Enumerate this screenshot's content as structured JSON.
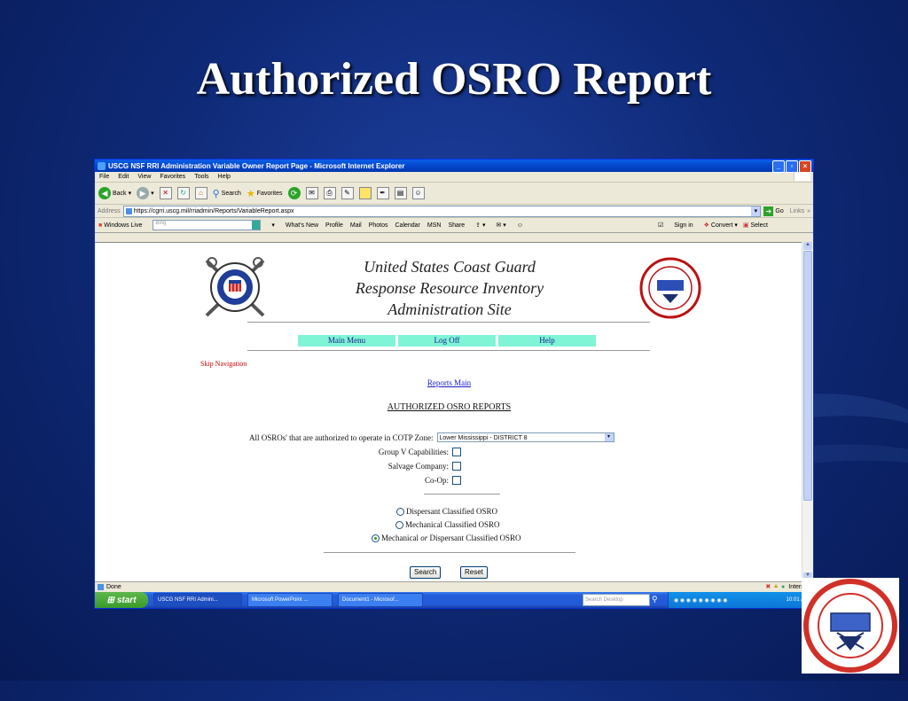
{
  "slide": {
    "title": "Authorized OSRO Report"
  },
  "browser": {
    "window_title": "USCG NSF RRI Administration Variable Owner Report Page - Microsoft Internet Explorer",
    "menu": [
      "File",
      "Edit",
      "View",
      "Favorites",
      "Tools",
      "Help"
    ],
    "toolbar": {
      "back": "Back",
      "search": "Search",
      "favorites": "Favorites"
    },
    "address_label": "Address",
    "address_url": "https://cgrri.uscg.mil/rriadmin/Reports/VariableReport.aspx",
    "go": "Go",
    "links": "Links",
    "links_bar": {
      "windows_live": "Windows Live",
      "bing_placeholder": "Bing",
      "items": [
        "What's New",
        "Profile",
        "Mail",
        "Photos",
        "Calendar",
        "MSN",
        "Share"
      ],
      "sign_in": "Sign in",
      "convert": "Convert",
      "select": "Select"
    },
    "status": "Done",
    "zone": "Internet"
  },
  "page": {
    "site_title": [
      "United States Coast Guard",
      "Response Resource Inventory",
      "Administration Site"
    ],
    "seal_text": "UNITED STATES COAST GUARD",
    "seal_year": "1790",
    "nsf_text": [
      "NATIONAL STRIKE FORCE",
      "NSF",
      "U.S. COAST GUARD"
    ],
    "nav": [
      "Main Menu",
      "Log Off",
      "Help"
    ],
    "skip_navigation": "Skip Navigation",
    "reports_main": "Reports Main",
    "heading": "AUTHORIZED OSRO REPORTS",
    "zone_label": "All OSROs' that are authorized to operate in COTP Zone:",
    "zone_value": "Lower Mississippi - DISTRICT 8",
    "checkboxes": [
      "Group V Capabilities:",
      "Salvage Company:",
      "Co-Op:"
    ],
    "radios": [
      {
        "label": "Dispersant Classified OSRO",
        "selected": false
      },
      {
        "label": "Mechanical Classified OSRO",
        "selected": false
      },
      {
        "label_pre": "Mechanical ",
        "label_em": "or",
        "label_post": " Dispersant Classified OSRO",
        "selected": true
      }
    ],
    "search_button": "Search",
    "reset_button": "Reset"
  },
  "taskbar": {
    "start": "start",
    "tasks": [
      "USCG NSF RRI Admini...",
      "Microsoft PowerPoint ...",
      "Document1 - Microsof..."
    ],
    "search_placeholder": "Search Desktop",
    "clock": "10:01 AM"
  }
}
